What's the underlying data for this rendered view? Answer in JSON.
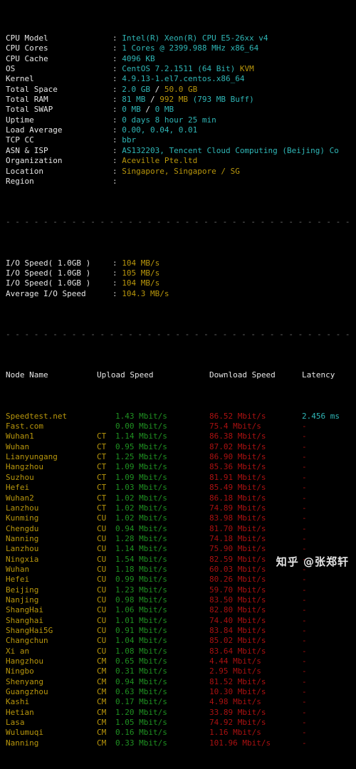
{
  "system_info": {
    "rows": [
      {
        "label": "CPU Model",
        "segments": [
          {
            "text": "Intel(R) Xeon(R) CPU E5-26xx v4",
            "color": "cyan"
          }
        ]
      },
      {
        "label": "CPU Cores",
        "segments": [
          {
            "text": "1 Cores @ 2399.988 MHz x86_64",
            "color": "cyan"
          }
        ]
      },
      {
        "label": "CPU Cache",
        "segments": [
          {
            "text": "4096 KB",
            "color": "cyan"
          }
        ]
      },
      {
        "label": "OS",
        "segments": [
          {
            "text": "CentOS 7.2.1511 (64 Bit) ",
            "color": "cyan"
          },
          {
            "text": "KVM",
            "color": "yellow"
          }
        ]
      },
      {
        "label": "Kernel",
        "segments": [
          {
            "text": "4.9.13-1.el7.centos.x86_64",
            "color": "cyan"
          }
        ]
      },
      {
        "label": "Total Space",
        "segments": [
          {
            "text": "2.0 GB ",
            "color": "cyan"
          },
          {
            "text": "/ ",
            "color": "white"
          },
          {
            "text": "50.0 GB",
            "color": "yellow"
          }
        ]
      },
      {
        "label": "Total RAM",
        "segments": [
          {
            "text": "81 MB ",
            "color": "cyan"
          },
          {
            "text": "/ ",
            "color": "white"
          },
          {
            "text": "992 MB ",
            "color": "yellow"
          },
          {
            "text": "(793 MB Buff)",
            "color": "cyan"
          }
        ]
      },
      {
        "label": "Total SWAP",
        "segments": [
          {
            "text": "0 MB ",
            "color": "cyan"
          },
          {
            "text": "/ ",
            "color": "white"
          },
          {
            "text": "0 MB",
            "color": "cyan"
          }
        ]
      },
      {
        "label": "Uptime",
        "segments": [
          {
            "text": "0 days 8 hour 25 min",
            "color": "cyan"
          }
        ]
      },
      {
        "label": "Load Average",
        "segments": [
          {
            "text": "0.00, 0.04, 0.01",
            "color": "cyan"
          }
        ]
      },
      {
        "label": "TCP CC",
        "segments": [
          {
            "text": "bbr",
            "color": "cyan"
          }
        ]
      },
      {
        "label": "ASN & ISP",
        "segments": [
          {
            "text": "AS132203, Tencent Cloud Computing (Beijing) Co",
            "color": "cyan"
          }
        ]
      },
      {
        "label": "Organization",
        "segments": [
          {
            "text": "Aceville Pte.ltd",
            "color": "yellow"
          }
        ]
      },
      {
        "label": "Location",
        "segments": [
          {
            "text": "Singapore, Singapore / SG",
            "color": "yellow"
          }
        ]
      },
      {
        "label": "Region",
        "segments": [
          {
            "text": "",
            "color": "yellow"
          }
        ]
      }
    ]
  },
  "io_section": {
    "rows": [
      {
        "label": "I/O Speed( 1.0GB )",
        "value": "104 MB/s"
      },
      {
        "label": "I/O Speed( 1.0GB )",
        "value": "105 MB/s"
      },
      {
        "label": "I/O Speed( 1.0GB )",
        "value": "104 MB/s"
      },
      {
        "label": "Average I/O Speed",
        "value": "104.3 MB/s"
      }
    ]
  },
  "speedtest": {
    "headers": {
      "node_name": "Node Name",
      "upload_speed": "Upload Speed",
      "download_speed": "Download Speed",
      "latency": "Latency"
    },
    "rows": [
      {
        "name": "Speedtest.net",
        "isp": "",
        "upload": "1.43 Mbit/s",
        "download": "86.52 Mbit/s",
        "latency": "2.456 ms"
      },
      {
        "name": "Fast.com",
        "isp": "",
        "upload": "0.00 Mbit/s",
        "download": "75.4 Mbit/s",
        "latency": "-"
      },
      {
        "name": "Wuhan1",
        "isp": "CT",
        "upload": "1.14 Mbit/s",
        "download": "86.38 Mbit/s",
        "latency": "-"
      },
      {
        "name": "Wuhan",
        "isp": "CT",
        "upload": "0.95 Mbit/s",
        "download": "87.02 Mbit/s",
        "latency": "-"
      },
      {
        "name": "Lianyungang",
        "isp": "CT",
        "upload": "1.25 Mbit/s",
        "download": "86.90 Mbit/s",
        "latency": "-"
      },
      {
        "name": "Hangzhou",
        "isp": "CT",
        "upload": "1.09 Mbit/s",
        "download": "85.36 Mbit/s",
        "latency": "-"
      },
      {
        "name": "Suzhou",
        "isp": "CT",
        "upload": "1.09 Mbit/s",
        "download": "81.91 Mbit/s",
        "latency": "-"
      },
      {
        "name": "Hefei",
        "isp": "CT",
        "upload": "1.03 Mbit/s",
        "download": "85.49 Mbit/s",
        "latency": "-"
      },
      {
        "name": "Wuhan2",
        "isp": "CT",
        "upload": "1.02 Mbit/s",
        "download": "86.18 Mbit/s",
        "latency": "-"
      },
      {
        "name": "Lanzhou",
        "isp": "CT",
        "upload": "1.02 Mbit/s",
        "download": "74.89 Mbit/s",
        "latency": "-"
      },
      {
        "name": "Kunming",
        "isp": "CU",
        "upload": "1.02 Mbit/s",
        "download": "83.98 Mbit/s",
        "latency": "-"
      },
      {
        "name": "Chengdu",
        "isp": "CU",
        "upload": "0.94 Mbit/s",
        "download": "81.70 Mbit/s",
        "latency": "-"
      },
      {
        "name": "Nanning",
        "isp": "CU",
        "upload": "1.28 Mbit/s",
        "download": "74.18 Mbit/s",
        "latency": "-"
      },
      {
        "name": "Lanzhou",
        "isp": "CU",
        "upload": "1.14 Mbit/s",
        "download": "75.90 Mbit/s",
        "latency": "-"
      },
      {
        "name": "Ningxia",
        "isp": "CU",
        "upload": "1.54 Mbit/s",
        "download": "82.59 Mbit/s",
        "latency": "-"
      },
      {
        "name": "Wuhan",
        "isp": "CU",
        "upload": "1.18 Mbit/s",
        "download": "60.03 Mbit/s",
        "latency": "-"
      },
      {
        "name": "Hefei",
        "isp": "CU",
        "upload": "0.99 Mbit/s",
        "download": "80.26 Mbit/s",
        "latency": "-"
      },
      {
        "name": "Beijing",
        "isp": "CU",
        "upload": "1.23 Mbit/s",
        "download": "59.70 Mbit/s",
        "latency": "-"
      },
      {
        "name": "Nanjing",
        "isp": "CU",
        "upload": "0.98 Mbit/s",
        "download": "83.50 Mbit/s",
        "latency": "-"
      },
      {
        "name": "ShangHai",
        "isp": "CU",
        "upload": "1.06 Mbit/s",
        "download": "82.80 Mbit/s",
        "latency": "-"
      },
      {
        "name": "Shanghai",
        "isp": "CU",
        "upload": "1.01 Mbit/s",
        "download": "74.40 Mbit/s",
        "latency": "-"
      },
      {
        "name": "ShangHai5G",
        "isp": "CU",
        "upload": "0.91 Mbit/s",
        "download": "83.84 Mbit/s",
        "latency": "-"
      },
      {
        "name": "Changchun",
        "isp": "CU",
        "upload": "1.04 Mbit/s",
        "download": "85.02 Mbit/s",
        "latency": "-"
      },
      {
        "name": "Xi an",
        "isp": "CU",
        "upload": "1.08 Mbit/s",
        "download": "83.64 Mbit/s",
        "latency": "-"
      },
      {
        "name": "Hangzhou",
        "isp": "CM",
        "upload": "0.65 Mbit/s",
        "download": "4.44 Mbit/s",
        "latency": "-"
      },
      {
        "name": "Ningbo",
        "isp": "CM",
        "upload": "0.31 Mbit/s",
        "download": "2.95 Mbit/s",
        "latency": "-"
      },
      {
        "name": "Shenyang",
        "isp": "CM",
        "upload": "0.94 Mbit/s",
        "download": "81.52 Mbit/s",
        "latency": "-"
      },
      {
        "name": "Guangzhou",
        "isp": "CM",
        "upload": "0.63 Mbit/s",
        "download": "10.30 Mbit/s",
        "latency": "-"
      },
      {
        "name": "Kashi",
        "isp": "CM",
        "upload": "0.17 Mbit/s",
        "download": "4.98 Mbit/s",
        "latency": "-"
      },
      {
        "name": "Hetian",
        "isp": "CM",
        "upload": "1.20 Mbit/s",
        "download": "33.89 Mbit/s",
        "latency": "-"
      },
      {
        "name": "Lasa",
        "isp": "CM",
        "upload": "1.05 Mbit/s",
        "download": "74.92 Mbit/s",
        "latency": "-"
      },
      {
        "name": "Wulumuqi",
        "isp": "CM",
        "upload": "0.16 Mbit/s",
        "download": "1.16 Mbit/s",
        "latency": "-"
      },
      {
        "name": "Nanning",
        "isp": "CM",
        "upload": "0.33 Mbit/s",
        "download": "101.96 Mbit/s",
        "latency": "-"
      }
    ]
  },
  "separator": "- - - - - - - - - - - - - - - - - - - - - - - - - - - - - - - - - - - - - - - - - - -",
  "watermark": "知乎 @张郑轩",
  "colors": {
    "background": "#000000",
    "label": "#e6e6e6",
    "cyan": "#2fb6b6",
    "yellow": "#b8960c",
    "green": "#1f9021",
    "red": "#aa1111",
    "separator": "#6e6e6e"
  }
}
